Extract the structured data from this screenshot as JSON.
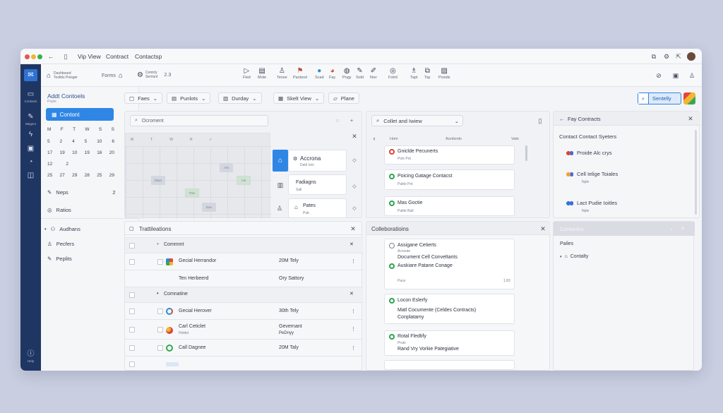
{
  "window": {
    "title_parts": [
      "Vip View",
      "Contract",
      "Contactsp"
    ],
    "colors": {
      "close": "#e8564c",
      "minimize": "#f1b33b",
      "maximize": "#35b24a",
      "rail": "#203662",
      "accent": "#2f86e5"
    }
  },
  "rail": {
    "items": [
      {
        "icon": "inbox-icon",
        "label": "Contacts"
      },
      {
        "icon": "pin-icon",
        "label": "Wagers"
      },
      {
        "icon": "bolt-icon",
        "label": ""
      },
      {
        "icon": "card-icon",
        "label": ""
      },
      {
        "icon": "bell-icon",
        "label": ""
      },
      {
        "icon": "trash-icon",
        "label": ""
      }
    ],
    "footer_label": "Help"
  },
  "toolbar": {
    "groups": [
      {
        "icon": "home-icon",
        "label": "Dashboard"
      },
      {
        "icon": "",
        "label": "Toolbls Poisger"
      },
      {
        "icon": "home-icon",
        "label": "Forms"
      },
      {
        "icon": "gear-icon",
        "label": "Contcly"
      },
      {
        "icon": "",
        "label": "Serriunt"
      },
      {
        "icon": "chevron-icon",
        "label": "2.3"
      },
      {
        "icon": "play-icon",
        "label": "Fled"
      },
      {
        "icon": "doc-icon",
        "label": "Mote"
      },
      {
        "icon": "person-icon",
        "label": "Tense"
      },
      {
        "icon": "flag-icon",
        "label": "Pacbool"
      },
      {
        "icon": "blue-circle-icon",
        "label": "Scad"
      },
      {
        "icon": "google-icon",
        "label": "Fay"
      },
      {
        "icon": "globe-icon",
        "label": "Pogy"
      },
      {
        "icon": "pen-icon",
        "label": "Sold"
      },
      {
        "icon": "pen-icon",
        "label": "Nov"
      },
      {
        "icon": "target-icon",
        "label": "Fotrd"
      },
      {
        "icon": "lamp-icon",
        "label": "Tapt"
      },
      {
        "icon": "copy-icon",
        "label": "Tay"
      },
      {
        "icon": "folder-icon",
        "label": "Posids"
      }
    ]
  },
  "sidebar": {
    "title": "Addt Contoels",
    "subtitle": "Pople",
    "primary_button": "Contont",
    "calendar": {
      "weekdays": [
        "M",
        "F",
        "T",
        "W",
        "S",
        "S"
      ],
      "rows": [
        [
          "5",
          "2",
          "4",
          "5",
          "10",
          "6"
        ],
        [
          "17",
          "19",
          "10",
          "19",
          "16",
          "20"
        ],
        [
          "12",
          "2",
          "",
          "",
          "",
          ""
        ],
        [
          "25",
          "27",
          "29",
          "28",
          "25",
          "29"
        ]
      ]
    },
    "items": [
      {
        "icon": "pen-icon",
        "label": "Neps",
        "count": "2"
      },
      {
        "icon": "circle-icon",
        "label": "Ratios",
        "count": ""
      },
      {
        "icon": "chevron-icon",
        "label": "Audhans",
        "count": ""
      },
      {
        "icon": "person-icon",
        "label": "Pecfers",
        "count": ""
      },
      {
        "icon": "pen-icon",
        "label": "Peplits",
        "count": ""
      }
    ]
  },
  "filters": [
    "Faes",
    "Punlots",
    "Durday",
    "Skelt View",
    "Plane"
  ],
  "search_button": "Sentelly",
  "calendar_panel": {
    "search_placeholder": "Ocroment",
    "weekday_heads": [
      "M",
      "T",
      "W",
      "R",
      ">"
    ],
    "events": [
      "Ast",
      "Dawr",
      "Ast",
      "Ttes",
      "Dav"
    ],
    "cards": [
      {
        "title": "Accrona",
        "subtitle": "Dald Ioin"
      },
      {
        "title": "Fadiagns",
        "subtitle": "Sall"
      },
      {
        "title": "Pates",
        "subtitle": "Pub"
      }
    ]
  },
  "collect_panel": {
    "dropdown": "Collet and Iwiew",
    "column_heads": [
      "Hom",
      "Aontionts",
      "Vate"
    ],
    "cards": [
      {
        "title": "Gniclde Pecunerts",
        "subtitle": "Pole Pot"
      },
      {
        "title": "Poicing Gatage Contacst",
        "subtitle": "Pablo Pot"
      },
      {
        "title": "Mas Goctie",
        "subtitle": "Pable Balt"
      }
    ]
  },
  "pay_panel": {
    "title": "Fay Contracts",
    "heading": "Contact Contact Syeters",
    "items": [
      {
        "title": "Proide Alc crys",
        "subtitle": ""
      },
      {
        "title": "Cell Ielige Toiales",
        "subtitle": "Nple"
      },
      {
        "title": "Lact Pudie Ioitles",
        "subtitle": "Nple"
      }
    ]
  },
  "transactions": {
    "title": "Trattileations",
    "groups": [
      {
        "label": "Commmt"
      },
      {
        "label": "Comnatine"
      }
    ],
    "rows": [
      {
        "name": "Gecial Herrandor",
        "sub": "",
        "value": "20M Tely",
        "value2": ""
      },
      {
        "name": "Ten Herbeerd",
        "sub": "",
        "value": "Ory Sattory",
        "value2": ""
      },
      {
        "name": "Gecial Herover",
        "sub": "",
        "value": "30th Tely",
        "value2": ""
      },
      {
        "name": "Carl Ceticlet",
        "sub": "Holdst",
        "value": "Gevernant",
        "value2": "PeDnyy"
      },
      {
        "name": "Call Dagnee",
        "sub": "",
        "value": "20M Taly",
        "value2": ""
      }
    ]
  },
  "collaborations": {
    "title": "Colleboratioins",
    "cards": [
      {
        "lines": [
          "Assigane Cetierts",
          "Acceute",
          "Document Cell Conveltants",
          "Auskiare Patane Conage"
        ],
        "meta": "Pace",
        "num": "1.83"
      },
      {
        "lines": [
          "Locon Eslerfy",
          "Matl Cocumente (Celdes Contracts)",
          "Conplatamy"
        ],
        "meta": "",
        "num": ""
      },
      {
        "lines": [
          "Rotal Fledtify",
          "Pruts",
          "Rand Vry Vorkie Pategiative"
        ],
        "meta": "",
        "num": ""
      }
    ]
  },
  "contacts_panel": {
    "title": "Contactos",
    "section": "Pailes",
    "item": "Contalty"
  }
}
